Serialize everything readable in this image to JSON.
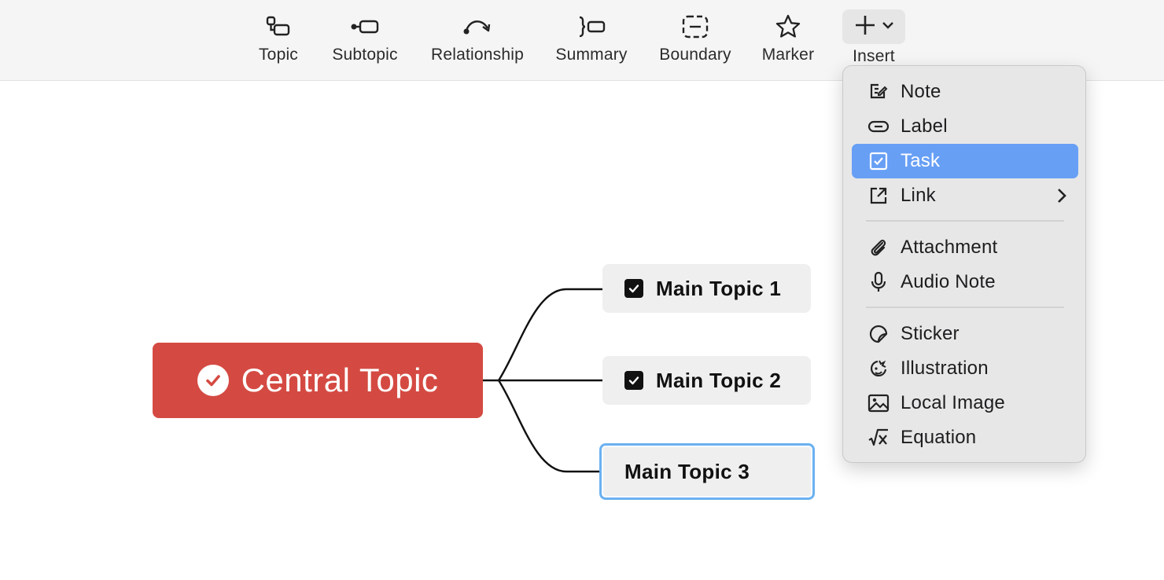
{
  "toolbar": {
    "items": [
      {
        "label": "Topic",
        "icon": "topic-icon"
      },
      {
        "label": "Subtopic",
        "icon": "subtopic-icon"
      },
      {
        "label": "Relationship",
        "icon": "relationship-icon"
      },
      {
        "label": "Summary",
        "icon": "summary-icon"
      },
      {
        "label": "Boundary",
        "icon": "boundary-icon"
      },
      {
        "label": "Marker",
        "icon": "marker-star-icon"
      },
      {
        "label": "Insert",
        "icon": "plus-icon"
      }
    ]
  },
  "mindmap": {
    "central": {
      "label": "Central Topic",
      "color": "#d44a42"
    },
    "topics": [
      {
        "label": "Main Topic 1",
        "task_checked": true
      },
      {
        "label": "Main Topic 2",
        "task_checked": true
      },
      {
        "label": "Main Topic 3",
        "selected": true
      }
    ]
  },
  "insert_menu": {
    "items": [
      {
        "label": "Note",
        "icon": "note-icon"
      },
      {
        "label": "Label",
        "icon": "label-icon"
      },
      {
        "label": "Task",
        "icon": "task-checkbox-icon",
        "highlighted": true
      },
      {
        "label": "Link",
        "icon": "link-icon",
        "has_submenu": true
      },
      {
        "label": "Attachment",
        "icon": "paperclip-icon"
      },
      {
        "label": "Audio Note",
        "icon": "microphone-icon"
      },
      {
        "label": "Sticker",
        "icon": "sticker-icon"
      },
      {
        "label": "Illustration",
        "icon": "illustration-icon"
      },
      {
        "label": "Local Image",
        "icon": "image-icon"
      },
      {
        "label": "Equation",
        "icon": "equation-icon"
      }
    ],
    "highlight_color": "#679ff5"
  }
}
